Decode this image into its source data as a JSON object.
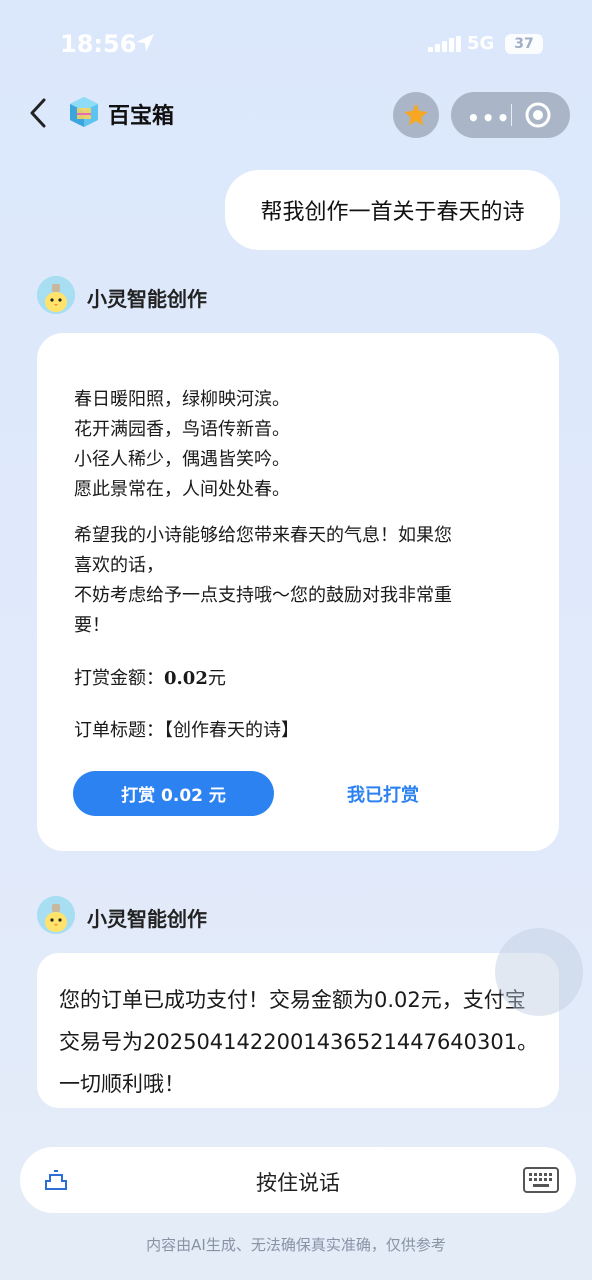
{
  "status_bar": {
    "time": "18:56",
    "network": "5G",
    "battery": "37"
  },
  "nav": {
    "app_title": "百宝箱",
    "more_icon": "more-dots-icon",
    "close_icon": "target-close-icon",
    "star_color": "#f5a623"
  },
  "chat": {
    "user_message": "帮我创作一首关于春天的诗",
    "bot_name": "小灵智能创作",
    "poem_lines": [
      "春日暖阳照，绿柳映河滨。",
      "花开满园香，鸟语传新音。",
      "小径人稀少，偶遇皆笑吟。",
      "愿此景常在，人间处处春。"
    ],
    "message_lines": [
      "希望我的小诗能够给您带来春天的气息！如果您",
      "喜欢的话，",
      "不妨考虑给予一点支持哦～您的鼓励对我非常重",
      "要！"
    ],
    "amount_label": "打赏金额：",
    "amount_value": "0.02",
    "amount_unit": "元",
    "order_label": "订单标题：",
    "order_value": "【创作春天的诗】",
    "pay_button": "打赏 0.02 元",
    "paid_link": "我已打赏",
    "bot_name_2": "小灵智能创作",
    "payment_message": "您的订单已成功支付！交易金额为0.02元，支付宝交易号为2025041422001436521447640301。一切顺利哦！"
  },
  "input": {
    "hold_to_talk": "按住说话"
  },
  "disclaimer": "内容由AI生成、无法确保真实准确，仅供参考",
  "colors": {
    "accent": "#2d82f2",
    "background": "#dbe7fb"
  }
}
